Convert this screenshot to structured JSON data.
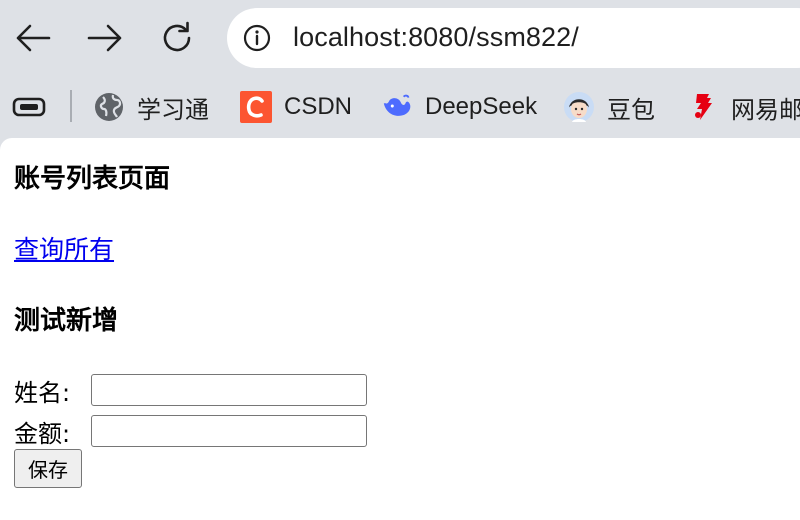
{
  "browser": {
    "url": "localhost:8080/ssm822/",
    "icons": {
      "back": "arrow-left-icon",
      "forward": "arrow-right-icon",
      "reload": "reload-icon",
      "site_info": "info-icon",
      "apps": "tab-group-icon"
    }
  },
  "bookmarks": [
    {
      "label": "学习通",
      "icon": "globe-icon"
    },
    {
      "label": "CSDN",
      "icon": "csdn-logo-icon",
      "color": "#fc5531"
    },
    {
      "label": "DeepSeek",
      "icon": "deepseek-whale-icon",
      "color": "#4d6bfe"
    },
    {
      "label": "豆包",
      "icon": "doubao-avatar-icon"
    },
    {
      "label": "网易邮",
      "icon": "netease-mail-icon",
      "color": "#e60012"
    }
  ],
  "page": {
    "title_list": "账号列表页面",
    "link_all": "查询所有",
    "title_add": "测试新增",
    "form": {
      "name_label": "姓名:",
      "name_value": "",
      "amount_label": "金额:",
      "amount_value": "",
      "save_label": "保存"
    }
  }
}
